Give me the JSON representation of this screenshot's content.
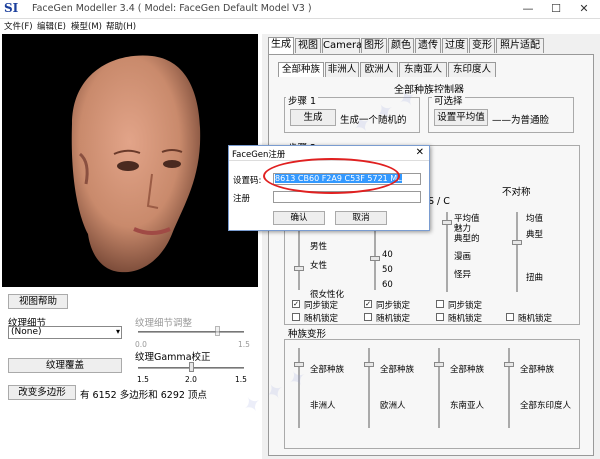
{
  "titlebar": {
    "logo": "SI",
    "title": "FaceGen Modeller 3.4  ( Model: FaceGen Default Model V3 )",
    "minimize": "—",
    "maximize": "☐",
    "close": "✕"
  },
  "menu": [
    "文件(F)",
    "编辑(E)",
    "模型(M)",
    "帮助(H)"
  ],
  "left_controls": {
    "view_help": "视图帮助",
    "texture_detail_label": "纹理细节",
    "texture_detail_adjust_label": "纹理细节调整",
    "texture_detail_value": "(None)",
    "detail_ticks": [
      "0.0",
      "1.5"
    ],
    "texture_overlay": "纹理覆盖",
    "gamma_label": "纹理Gamma校正",
    "gamma_ticks": [
      "1.5",
      "2.0",
      "1.5"
    ],
    "change_polygon": "改变多边形",
    "polygon_info": "有 6152 多边形和 6292 顶点"
  },
  "tabs": [
    "生成",
    "视图",
    "Camera",
    "图形",
    "颜色",
    "遗传",
    "过度",
    "变形",
    "照片适配"
  ],
  "subtabs": [
    "全部种族",
    "非洲人",
    "欧洲人",
    "东南亚人",
    "东印度人"
  ],
  "panel": {
    "section_title": "全部种族控制器",
    "step1": "步骤 1",
    "generate": "生成",
    "generate_desc": "生成一个随机的",
    "optional": "可选择",
    "set_average": "设置平均值",
    "set_average_desc": "——为普通脸",
    "step2": "步骤 2",
    "sym_label": "S / C",
    "asym_label": "不对称",
    "col1_labels": [
      "男性",
      "女性",
      "很女性化"
    ],
    "age_values": [
      "40",
      "50",
      "60"
    ],
    "col3_labels": [
      "平均值",
      "魅力",
      "典型的",
      "漫画",
      "怪异"
    ],
    "col4_labels": [
      "均值",
      "典型",
      "扭曲"
    ],
    "sync_lock": "同步锁定",
    "random_lock": "随机锁定",
    "race_morph": "种族变形",
    "morph_top": [
      "全部种族",
      "全部种族",
      "全部种族",
      "全部种族"
    ],
    "morph_bottom": [
      "非洲人",
      "欧洲人",
      "东南亚人",
      "全部东印度人"
    ]
  },
  "dialog": {
    "title": "FaceGen注册",
    "serial_label": "设置码:",
    "serial_value": "8613 CB60 F2A9 C53F 5721 ML",
    "reg_label": "注册",
    "ok": "确认",
    "cancel": "取消",
    "close": "✕"
  },
  "colors": {
    "highlight": "#3399ff",
    "annotation": "#e02020",
    "logo": "#1b3f9c"
  }
}
